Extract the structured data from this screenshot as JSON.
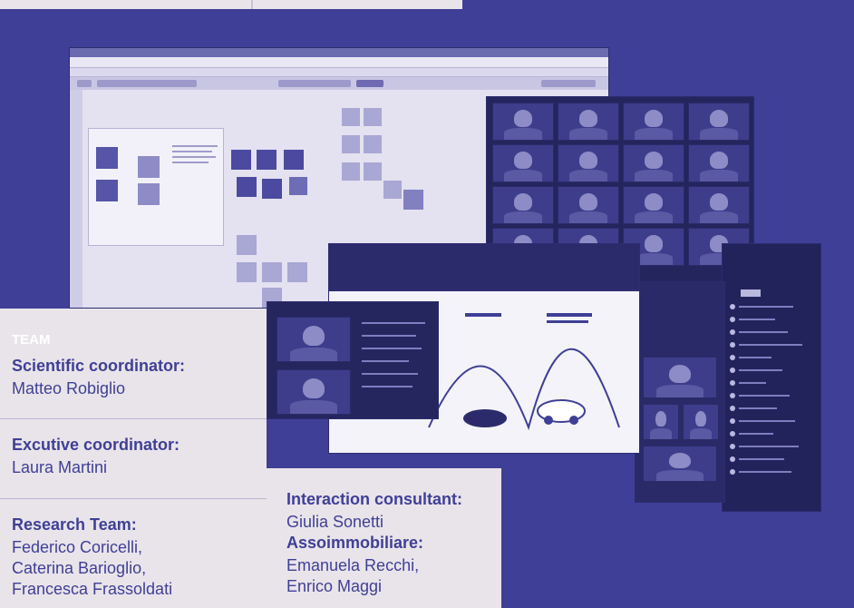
{
  "team": {
    "heading": "TEAM",
    "scientific": {
      "title": "Scientific coordinator:",
      "name": "Matteo Robiglio"
    },
    "executive": {
      "title": "Excutive coordinator:",
      "name": "Laura Martini"
    },
    "research": {
      "title": "Research Team:",
      "names": [
        "Federico Coricelli,",
        "Caterina Barioglio,",
        "Francesca Frassoldati"
      ]
    }
  },
  "consultants": {
    "interaction": {
      "title": "Interaction consultant:",
      "name": "Giulia Sonetti"
    },
    "assoimmobiliare": {
      "title": "Assoimmobiliare:",
      "names": [
        "Emanuela Recchi,",
        "Enrico Maggi"
      ]
    }
  },
  "colors": {
    "background": "#3f3f97",
    "panel": "#e9e4ea",
    "accent_text": "#3f3f97"
  },
  "images": [
    "online-whiteboard-screenshot",
    "video-call-grid-screenshot",
    "slide-presentation-screenshot",
    "participant-list-screenshot"
  ]
}
